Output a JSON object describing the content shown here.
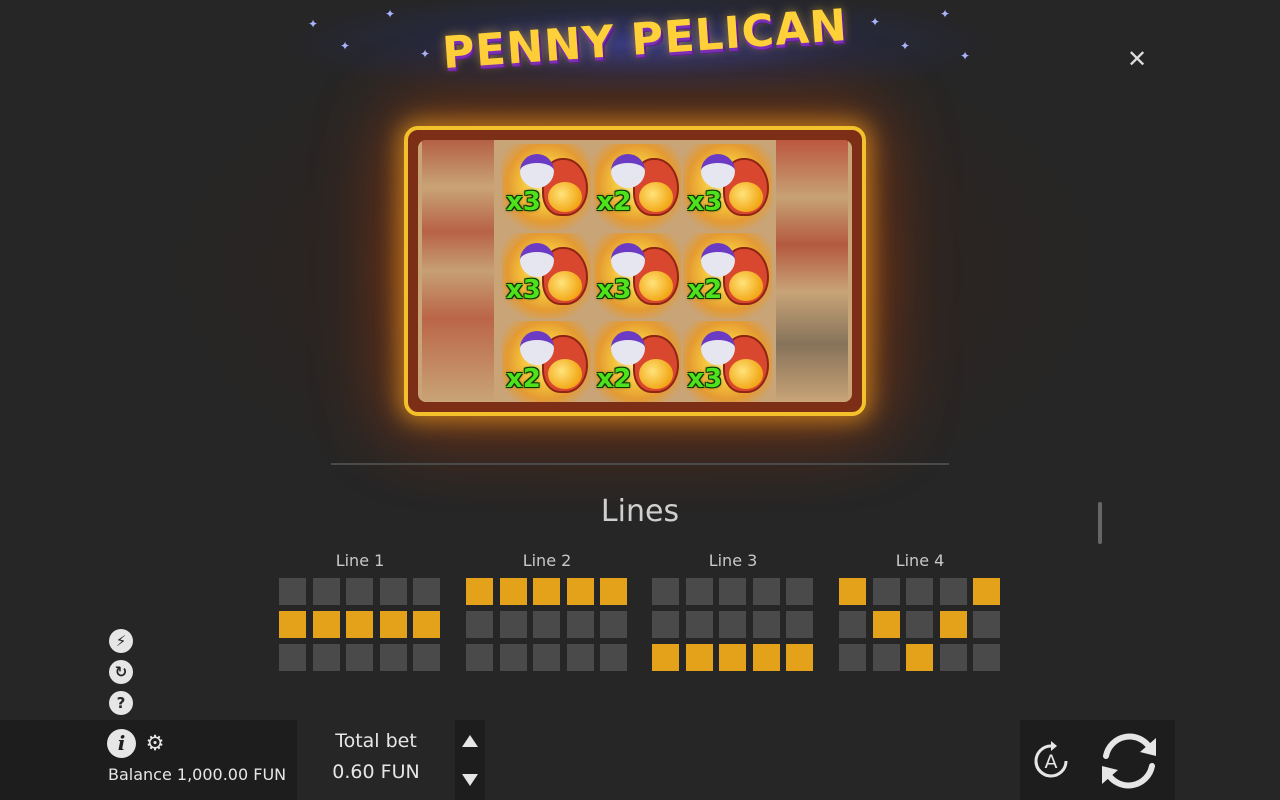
{
  "game": {
    "title": "PENNY PELICAN"
  },
  "preview": {
    "multipliers": [
      "x3",
      "x2",
      "x3",
      "x3",
      "x3",
      "x2",
      "x2",
      "x2",
      "x3"
    ]
  },
  "paytable": {
    "section_title": "Lines",
    "lines": [
      {
        "label": "Line 1",
        "pattern": [
          [
            0,
            0,
            0,
            0,
            0
          ],
          [
            1,
            1,
            1,
            1,
            1
          ],
          [
            0,
            0,
            0,
            0,
            0
          ]
        ]
      },
      {
        "label": "Line 2",
        "pattern": [
          [
            1,
            1,
            1,
            1,
            1
          ],
          [
            0,
            0,
            0,
            0,
            0
          ],
          [
            0,
            0,
            0,
            0,
            0
          ]
        ]
      },
      {
        "label": "Line 3",
        "pattern": [
          [
            0,
            0,
            0,
            0,
            0
          ],
          [
            0,
            0,
            0,
            0,
            0
          ],
          [
            1,
            1,
            1,
            1,
            1
          ]
        ]
      },
      {
        "label": "Line 4",
        "pattern": [
          [
            1,
            0,
            0,
            0,
            1
          ],
          [
            0,
            1,
            0,
            1,
            0
          ],
          [
            0,
            0,
            1,
            0,
            0
          ]
        ]
      }
    ]
  },
  "side_icons": [
    "turbo-icon",
    "history-icon",
    "help-icon"
  ],
  "bottom_bar": {
    "balance_text": "Balance 1,000.00 FUN",
    "total_bet_label": "Total bet",
    "total_bet_value": "0.60 FUN",
    "autoplay_label": "A"
  },
  "colors": {
    "active_cell": "#e3a21a",
    "inactive_cell": "#4a4a4a",
    "multiplier": "#4ee11c",
    "frame": "#f3c12c"
  }
}
